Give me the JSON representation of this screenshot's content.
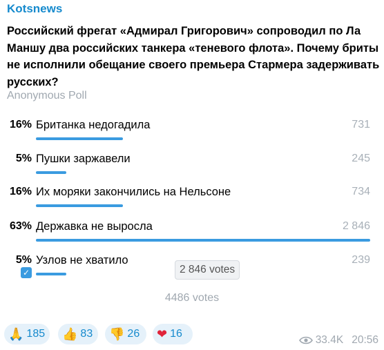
{
  "message": {
    "channel": "Kotsnews",
    "question": "Российский фрегат «Адмирал Григорович» сопроводил по Ла Маншу два российских танкера «теневого флота». Почему бриты не исполнили обещание своего премьера Стармера задерживать русских?",
    "poll_type": "Anonymous Poll",
    "options": [
      {
        "percent": "16%",
        "text": "Британка недогадила",
        "votes": "731",
        "fraction": 0.26
      },
      {
        "percent": "5%",
        "text": "Пушки заржавели",
        "votes": "245",
        "fraction": 0.09
      },
      {
        "percent": "16%",
        "text": "Их моряки закончились на Нельсоне",
        "votes": "734",
        "fraction": 0.26
      },
      {
        "percent": "63%",
        "text": "Державка не выросла",
        "votes": "2 846",
        "fraction": 1.0
      },
      {
        "percent": "5%",
        "text": "Узлов не хватило",
        "votes": "239",
        "fraction": 0.09,
        "selected": true
      }
    ],
    "tooltip": "2 846 votes",
    "total_votes": "4486 votes",
    "reactions": [
      {
        "emoji": "🙏",
        "count": "185",
        "icon": "pray-icon"
      },
      {
        "emoji": "👍",
        "count": "83",
        "icon": "thumbs-up-icon"
      },
      {
        "emoji": "👎",
        "count": "26",
        "icon": "thumbs-down-icon"
      },
      {
        "emoji": "❤",
        "count": "16",
        "icon": "heart-icon"
      }
    ],
    "views": "33.4K",
    "time": "20:56",
    "colors": {
      "accent": "#3a9be0",
      "channel": "#168acd",
      "muted": "#a0a8b0"
    }
  }
}
